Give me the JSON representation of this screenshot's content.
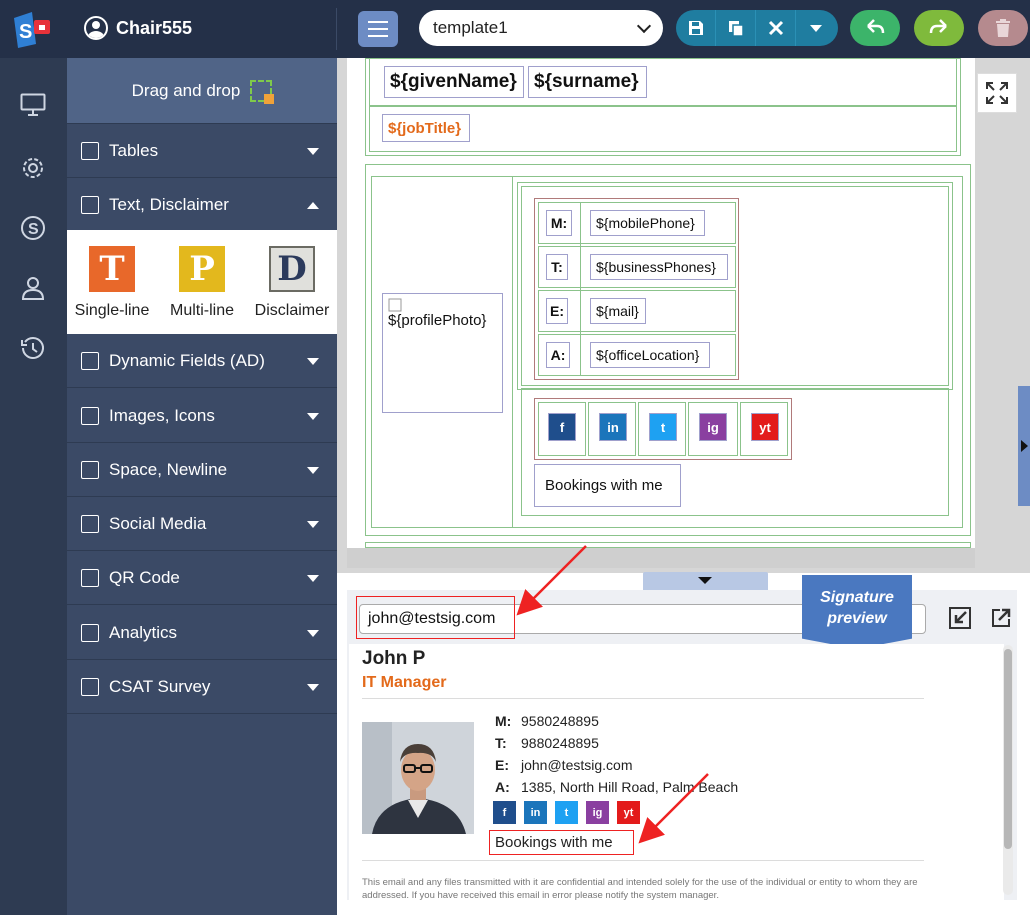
{
  "app": {
    "user_name": "Chair555"
  },
  "toolbar": {
    "template_value": "template1",
    "icons": [
      "menu-icon",
      "save-icon",
      "copy-icon",
      "close-icon",
      "dropdown-icon",
      "undo-icon",
      "redo-icon",
      "trash-icon"
    ]
  },
  "rail": {
    "icons": [
      "monitor-icon",
      "gear-icon",
      "dollar-icon",
      "user-icon",
      "history-icon"
    ]
  },
  "panel": {
    "drag_drop_label": "Drag and drop",
    "sections": [
      {
        "label": "Tables"
      },
      {
        "label": "Text, Disclaimer"
      },
      {
        "label": "Dynamic Fields (AD)"
      },
      {
        "label": "Images, Icons"
      },
      {
        "label": "Space, Newline"
      },
      {
        "label": "Social Media"
      },
      {
        "label": "QR Code"
      },
      {
        "label": "Analytics"
      },
      {
        "label": "CSAT Survey"
      }
    ],
    "text_items": [
      {
        "letter": "T",
        "label": "Single-line",
        "color": "#e8682a"
      },
      {
        "letter": "P",
        "label": "Multi-line",
        "color": "#e3b81d"
      },
      {
        "letter": "D",
        "label": "Disclaimer",
        "color": "#6b6b63"
      }
    ]
  },
  "editor": {
    "given_name": "${givenName}",
    "surname": "${surname}",
    "job_title": "${jobTitle}",
    "profile_photo": "${profilePhoto}",
    "contacts": [
      {
        "key": "M:",
        "value": "${mobilePhone}"
      },
      {
        "key": "T:",
        "value": "${businessPhones}"
      },
      {
        "key": "E:",
        "value": "${mail}"
      },
      {
        "key": "A:",
        "value": "${officeLocation}"
      }
    ],
    "social": [
      {
        "label": "f",
        "color": "#1f4e8c"
      },
      {
        "label": "in",
        "color": "#1b75bb"
      },
      {
        "label": "t",
        "color": "#1ea1f2"
      },
      {
        "label": "ig",
        "color": "#8a3fa0"
      },
      {
        "label": "yt",
        "color": "#e31b1b"
      }
    ],
    "bookings": "Bookings with me"
  },
  "preview": {
    "email": "john@testsig.com",
    "ribbon_line1": "Signature",
    "ribbon_line2": "preview",
    "name": "John P",
    "title": "IT Manager",
    "contacts": [
      {
        "key": "M:",
        "value": "9580248895"
      },
      {
        "key": "T:",
        "value": "9880248895"
      },
      {
        "key": "E:",
        "value": "john@testsig.com"
      },
      {
        "key": "A:",
        "value": "1385, North Hill Road, Palm Beach"
      }
    ],
    "bookings": "Bookings with me",
    "disclaimer": "This email and any files transmitted with it are confidential and intended solely for the use of the individual or entity to whom they are addressed. If you have received this email in error please notify the system manager."
  },
  "colors": {
    "accent": "#243048",
    "orange": "#e36a1b",
    "annotation_red": "#e22222"
  }
}
